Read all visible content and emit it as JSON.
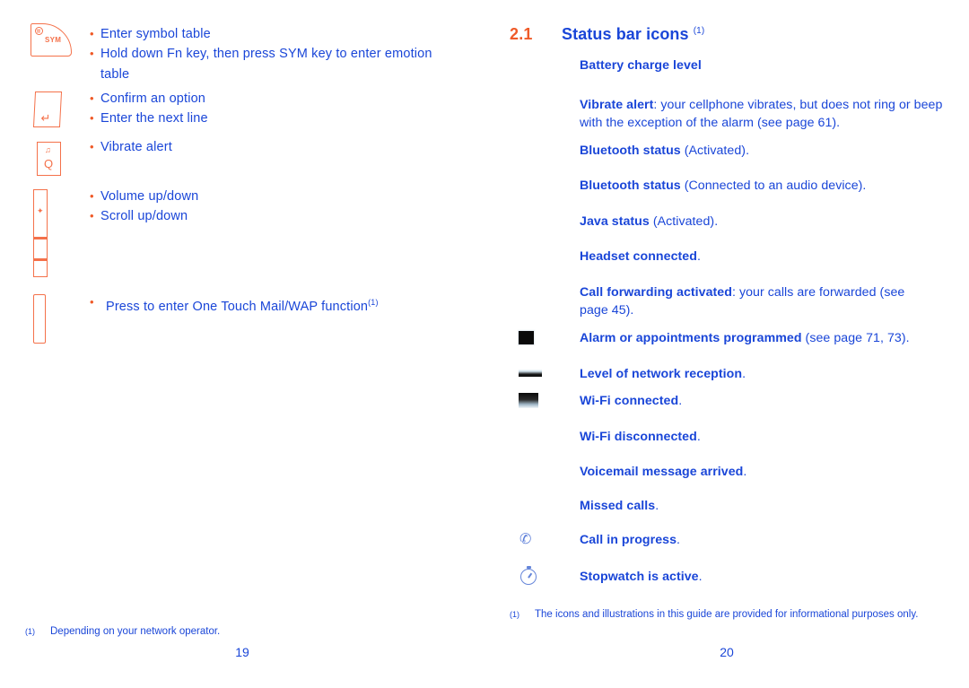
{
  "document": {
    "type": "user-manual-spread",
    "colors": {
      "blue_text": "#1a46d8",
      "orange_accent": "#ef5a28",
      "key_outline": "#f4714a"
    }
  },
  "left_page": {
    "page_number": "19",
    "key_groups": [
      {
        "key_icon": "sym-key-icon",
        "key_glyphs": {
          "smiley": "smiley-face",
          "label": "SYM"
        },
        "bullets": [
          "Enter symbol table",
          "Hold down Fn key, then press SYM key to enter emotion table"
        ]
      },
      {
        "key_icon": "enter-key-icon",
        "key_glyphs": {
          "arrow": "↵"
        },
        "bullets": [
          "Confirm an option",
          "Enter the next line"
        ]
      },
      {
        "key_icon": "vibrate-q-key-icon",
        "key_glyphs": {
          "vibrate": "vibrate-glyph",
          "letter": "Q"
        },
        "bullets": [
          "Vibrate alert"
        ]
      },
      {
        "key_icon": "volume-side-key-icon",
        "key_glyphs": {
          "updown": "✦"
        },
        "bullets": [
          "Volume up/down",
          "Scroll up/down"
        ]
      },
      {
        "key_icon": "one-touch-side-key-icon",
        "key_glyphs": {},
        "bullets": [
          "Press to enter One Touch Mail/WAP function"
        ],
        "bullet_superscript": "(1)"
      }
    ],
    "footnote": {
      "marker": "(1)",
      "text": "Depending on your network operator."
    }
  },
  "right_page": {
    "page_number": "20",
    "section": {
      "number": "2.1",
      "title": "Status bar icons",
      "title_superscript": "(1)"
    },
    "status_items": [
      {
        "icon": "battery-icon",
        "icon_style": "none",
        "label": "Battery charge level",
        "detail": ""
      },
      {
        "icon": "vibrate-alert-icon",
        "icon_style": "none",
        "label": "Vibrate alert",
        "detail": ": your cellphone vibrates, but does not ring or beep with the exception of the alarm (see page 61)."
      },
      {
        "icon": "bluetooth-activated-icon",
        "icon_style": "none",
        "label": "Bluetooth status",
        "detail": " (Activated)."
      },
      {
        "icon": "bluetooth-audio-icon",
        "icon_style": "none",
        "label": "Bluetooth status",
        "detail": " (Connected to an audio device)."
      },
      {
        "icon": "java-status-icon",
        "icon_style": "none",
        "label": "Java status",
        "detail": " (Activated)."
      },
      {
        "icon": "headset-icon",
        "icon_style": "none",
        "label": "Headset connected",
        "detail": "."
      },
      {
        "icon": "call-forwarding-icon",
        "icon_style": "none",
        "label": "Call forwarding activated",
        "detail": ": your calls are forwarded (see page 45)."
      },
      {
        "icon": "alarm-icon",
        "icon_style": "black-square",
        "label": "Alarm or appointments programmed",
        "detail": " (see page 71, 73)."
      },
      {
        "icon": "network-reception-icon",
        "icon_style": "signal-bars",
        "label": "Level of network reception",
        "detail": "."
      },
      {
        "icon": "wifi-connected-icon",
        "icon_style": "wifi-block",
        "label": "Wi-Fi connected",
        "detail": "."
      },
      {
        "icon": "wifi-disconnected-icon",
        "icon_style": "none",
        "label": "Wi-Fi disconnected",
        "detail": "."
      },
      {
        "icon": "voicemail-icon",
        "icon_style": "none",
        "label": "Voicemail message arrived",
        "detail": "."
      },
      {
        "icon": "missed-calls-icon",
        "icon_style": "none",
        "label": "Missed calls",
        "detail": "."
      },
      {
        "icon": "call-in-progress-icon",
        "icon_style": "phone",
        "label": "Call in progress",
        "detail": "."
      },
      {
        "icon": "stopwatch-icon",
        "icon_style": "stopwatch",
        "label": "Stopwatch is active",
        "detail": "."
      }
    ],
    "footnote": {
      "marker": "(1)",
      "text": "The icons and illustrations in this guide are provided for informational purposes only."
    }
  }
}
